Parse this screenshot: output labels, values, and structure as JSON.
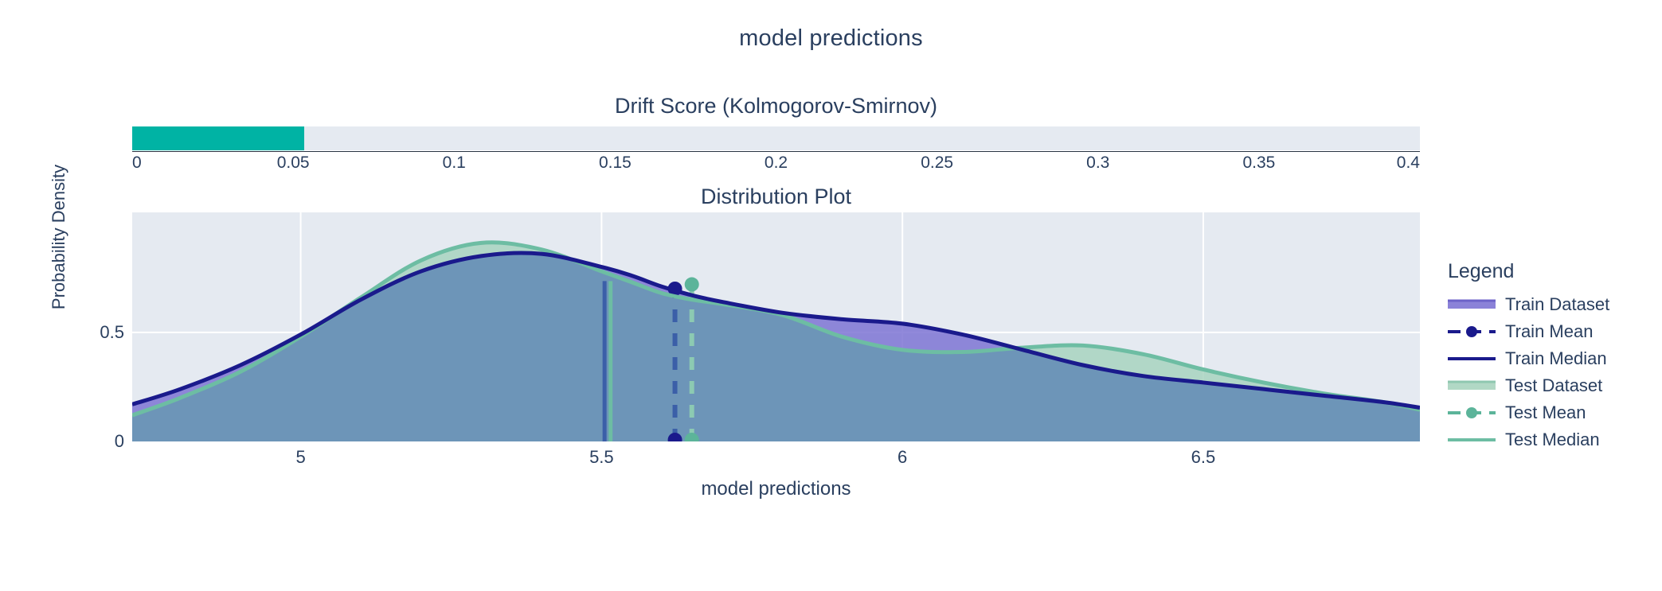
{
  "page": {
    "title": "model predictions"
  },
  "drift": {
    "title": "Drift Score (Kolmogorov-Smirnov)",
    "value": 0.0535,
    "axis_min": 0,
    "axis_max": 0.4,
    "ticks": [
      "0",
      "0.05",
      "0.1",
      "0.15",
      "0.2",
      "0.25",
      "0.3",
      "0.35",
      "0.4"
    ],
    "tick_values": [
      0,
      0.05,
      0.1,
      0.15,
      0.2,
      0.25,
      0.3,
      0.35,
      0.4
    ],
    "bar_color": "#00b3a4",
    "track_color": "#e5eaf1"
  },
  "distribution": {
    "title": "Distribution Plot",
    "xlabel": "model predictions",
    "ylabel": "Probability Density"
  },
  "legend": {
    "title": "Legend",
    "items": [
      {
        "label": "Train Dataset",
        "kind": "area",
        "color": "#6c62c8",
        "fill": "#7e74d4"
      },
      {
        "label": "Train Mean",
        "kind": "dashdot",
        "color": "#1a1a8c",
        "fill": "#1a1a8c"
      },
      {
        "label": "Train Median",
        "kind": "line",
        "color": "#1a1a8c",
        "fill": "#1a1a8c"
      },
      {
        "label": "Test Dataset",
        "kind": "area",
        "color": "#8fc7b0",
        "fill": "#a8d4bf"
      },
      {
        "label": "Test Mean",
        "kind": "dashdot",
        "color": "#5cb49a",
        "fill": "#5cb49a"
      },
      {
        "label": "Test Median",
        "kind": "line",
        "color": "#6dbda3",
        "fill": "#6dbda3"
      }
    ]
  },
  "chart_data": {
    "type": "area",
    "title": "Distribution Plot",
    "xlabel": "model predictions",
    "ylabel": "Probability Density",
    "xlim": [
      4.72,
      6.86
    ],
    "ylim": [
      0,
      1.05
    ],
    "xticks": [
      5,
      5.5,
      6,
      6.5
    ],
    "xtick_labels": [
      "5",
      "5.5",
      "6",
      "6.5"
    ],
    "yticks": [
      0,
      0.5
    ],
    "ytick_labels": [
      "0",
      "0.5"
    ],
    "grid": true,
    "legend_position": "right",
    "plot_bgcolor": "#e5eaf1",
    "gridcolor": "#ffffff",
    "series": [
      {
        "name": "Train Dataset",
        "line_color": "#1a1a8c",
        "fill_color": "#7e74d4",
        "x": [
          4.72,
          4.8,
          4.9,
          5.0,
          5.1,
          5.2,
          5.3,
          5.4,
          5.5,
          5.55,
          5.6,
          5.65,
          5.7,
          5.8,
          5.9,
          6.0,
          6.1,
          6.2,
          6.3,
          6.4,
          6.5,
          6.6,
          6.7,
          6.8,
          6.86
        ],
        "y": [
          0.17,
          0.24,
          0.35,
          0.49,
          0.65,
          0.78,
          0.85,
          0.86,
          0.8,
          0.76,
          0.71,
          0.67,
          0.64,
          0.59,
          0.56,
          0.54,
          0.49,
          0.42,
          0.35,
          0.3,
          0.27,
          0.24,
          0.21,
          0.18,
          0.155
        ]
      },
      {
        "name": "Test Dataset",
        "line_color": "#6dbda3",
        "fill_color": "#a8d4bf",
        "x": [
          4.72,
          4.8,
          4.9,
          5.0,
          5.1,
          5.2,
          5.3,
          5.4,
          5.5,
          5.55,
          5.6,
          5.65,
          5.7,
          5.8,
          5.9,
          6.0,
          6.1,
          6.2,
          6.3,
          6.4,
          6.5,
          6.6,
          6.7,
          6.8,
          6.86
        ],
        "y": [
          0.12,
          0.2,
          0.32,
          0.48,
          0.66,
          0.83,
          0.91,
          0.88,
          0.78,
          0.73,
          0.68,
          0.65,
          0.63,
          0.58,
          0.48,
          0.42,
          0.41,
          0.43,
          0.44,
          0.4,
          0.33,
          0.27,
          0.22,
          0.18,
          0.145
        ]
      }
    ],
    "markers": [
      {
        "name": "Train Median",
        "x": 5.505,
        "value": 5.505,
        "style": "solid",
        "color": "#3b5fa8"
      },
      {
        "name": "Test Median",
        "x": 5.515,
        "value": 5.515,
        "style": "solid",
        "color": "#6dbda3"
      },
      {
        "name": "Train Mean",
        "x": 5.622,
        "value": 5.622,
        "style": "dashed",
        "color": "#3b5fa8",
        "dot_color": "#1a1a8c",
        "top_y": 0.7
      },
      {
        "name": "Test Mean",
        "x": 5.65,
        "value": 5.65,
        "style": "dashed",
        "color": "#8ccab2",
        "dot_color": "#5cb49a",
        "top_y": 0.72
      }
    ]
  }
}
